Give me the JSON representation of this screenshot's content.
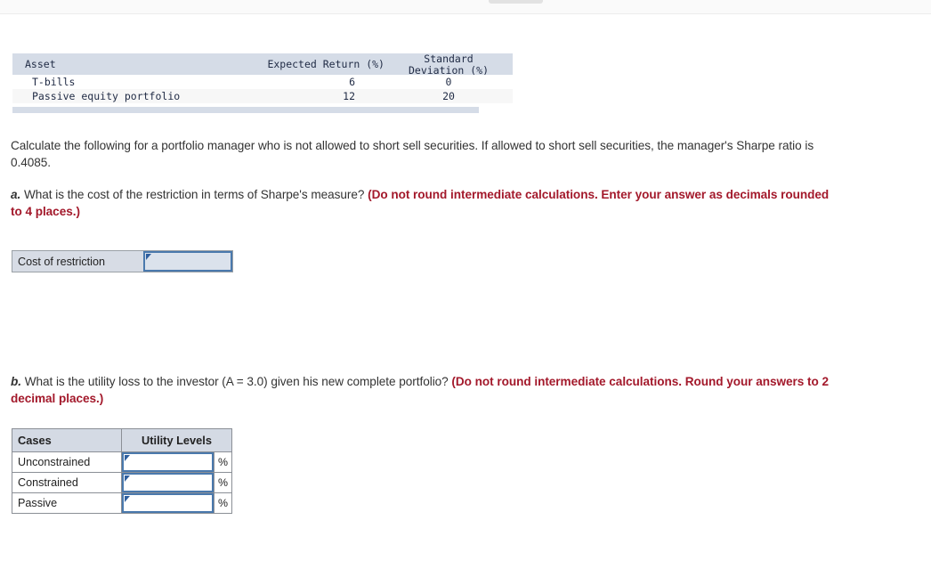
{
  "asset_table": {
    "headers": [
      "Asset",
      "Expected Return (%)",
      "Standard Deviation (%)"
    ],
    "header_sd_line1": "Standard",
    "header_sd_line2": "Deviation (%)",
    "rows": [
      {
        "asset": "T-bills",
        "expected_return": "6",
        "std_dev": "0"
      },
      {
        "asset": "Passive equity portfolio",
        "expected_return": "12",
        "std_dev": "20"
      }
    ]
  },
  "intro": {
    "text": "Calculate the following for a portfolio manager who is not allowed to short sell securities. If allowed to short sell securities, the manager's Sharpe ratio is 0.4085."
  },
  "question_a": {
    "label": "a.",
    "text": " What is the cost of the restriction in terms of Sharpe's measure? ",
    "note": "(Do not round intermediate calculations. Enter your answer as decimals rounded to 4 places.)"
  },
  "cost_widget": {
    "label": "Cost of restriction",
    "value": "",
    "placeholder": ""
  },
  "question_b": {
    "label": "b.",
    "text": " What is the utility loss to the investor (A = 3.0) given his new complete portfolio? ",
    "note": "(Do not round intermediate calculations. Round your answers to 2 decimal places.)"
  },
  "utility_table": {
    "headers": [
      "Cases",
      "Utility Levels"
    ],
    "unit": "%",
    "rows": [
      {
        "case": "Unconstrained",
        "value": "",
        "unit": "%"
      },
      {
        "case": "Constrained",
        "value": "",
        "unit": "%"
      },
      {
        "case": "Passive",
        "value": "",
        "unit": "%"
      }
    ]
  },
  "colors": {
    "note_red": "#a3192b",
    "table_header_blue": "#d5dce7",
    "input_border": "#4a79ad",
    "input_marker": "#2f5f9e"
  }
}
